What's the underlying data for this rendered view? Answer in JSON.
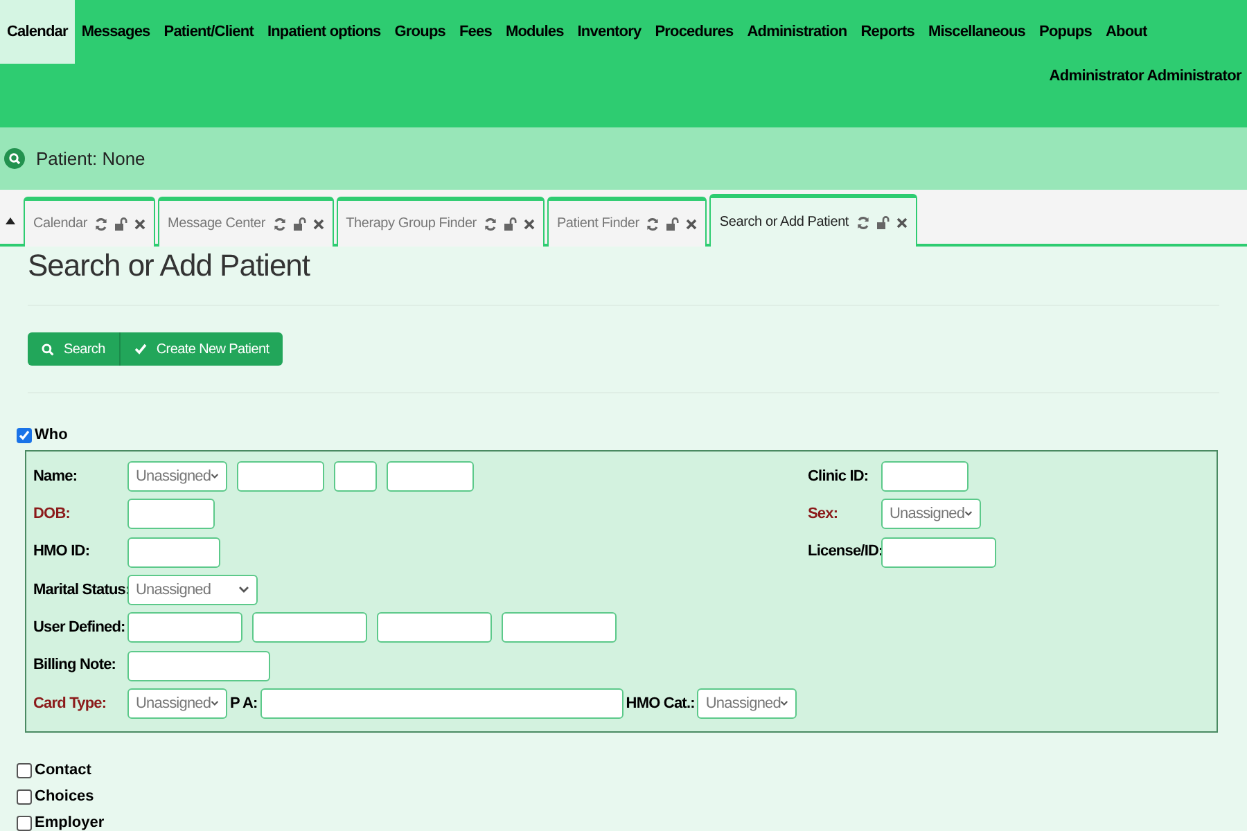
{
  "menu": [
    {
      "label": "Calendar",
      "selected": true
    },
    {
      "label": "Messages",
      "selected": false
    },
    {
      "label": "Patient/Client",
      "selected": false
    },
    {
      "label": "Inpatient options",
      "selected": false
    },
    {
      "label": "Groups",
      "selected": false
    },
    {
      "label": "Fees",
      "selected": false
    },
    {
      "label": "Modules",
      "selected": false
    },
    {
      "label": "Inventory",
      "selected": false
    },
    {
      "label": "Procedures",
      "selected": false
    },
    {
      "label": "Administration",
      "selected": false
    },
    {
      "label": "Reports",
      "selected": false
    },
    {
      "label": "Miscellaneous",
      "selected": false
    },
    {
      "label": "Popups",
      "selected": false
    },
    {
      "label": "About",
      "selected": false
    }
  ],
  "user": "Administrator Administrator",
  "patient_bar": {
    "label": "Patient: None"
  },
  "tabs": [
    {
      "label": "Calendar",
      "selected": false
    },
    {
      "label": "Message Center",
      "selected": false
    },
    {
      "label": "Therapy Group Finder",
      "selected": false
    },
    {
      "label": "Patient Finder",
      "selected": false
    },
    {
      "label": "Search or Add Patient",
      "selected": true
    }
  ],
  "page_title": "Search or Add Patient",
  "buttons": [
    {
      "label": "Search",
      "kind": "search"
    },
    {
      "label": "Create New Patient",
      "kind": "create"
    }
  ],
  "who": {
    "label": "Who",
    "checked": true,
    "left_rows": [
      {
        "label": "Name:",
        "required": false,
        "controls": [
          {
            "kind": "select",
            "value": "Unassigned"
          },
          {
            "kind": "input"
          },
          {
            "kind": "input"
          },
          {
            "kind": "input"
          }
        ]
      },
      {
        "label": "DOB:",
        "required": true,
        "controls": [
          {
            "kind": "input"
          }
        ]
      },
      {
        "label": "HMO ID:",
        "required": false,
        "controls": [
          {
            "kind": "input"
          }
        ]
      },
      {
        "label": "Marital Status:",
        "required": false,
        "controls": [
          {
            "kind": "select",
            "value": "Unassigned"
          }
        ]
      },
      {
        "label": "User Defined:",
        "required": false,
        "controls": [
          {
            "kind": "input"
          },
          {
            "kind": "input"
          },
          {
            "kind": "input"
          },
          {
            "kind": "input"
          }
        ]
      },
      {
        "label": "Billing Note:",
        "required": false,
        "controls": [
          {
            "kind": "input"
          }
        ]
      },
      {
        "label": "Card Type:",
        "required": true,
        "controls": [
          {
            "kind": "select",
            "value": "Unassigned"
          },
          {
            "kind": "label",
            "text": "P A:"
          },
          {
            "kind": "input"
          },
          {
            "kind": "label",
            "text": "HMO Cat.:"
          },
          {
            "kind": "select",
            "value": "Unassigned"
          }
        ]
      }
    ],
    "right_rows": [
      {
        "label": "Clinic ID:",
        "required": false,
        "controls": [
          {
            "kind": "input"
          }
        ]
      },
      {
        "label": "Sex:",
        "required": true,
        "controls": [
          {
            "kind": "select",
            "value": "Unassigned"
          }
        ]
      },
      {
        "label": "License/ID:",
        "required": false,
        "controls": [
          {
            "kind": "input"
          }
        ]
      }
    ]
  },
  "sections": [
    {
      "label": "Contact",
      "checked": false
    },
    {
      "label": "Choices",
      "checked": false
    },
    {
      "label": "Employer",
      "checked": false
    }
  ]
}
